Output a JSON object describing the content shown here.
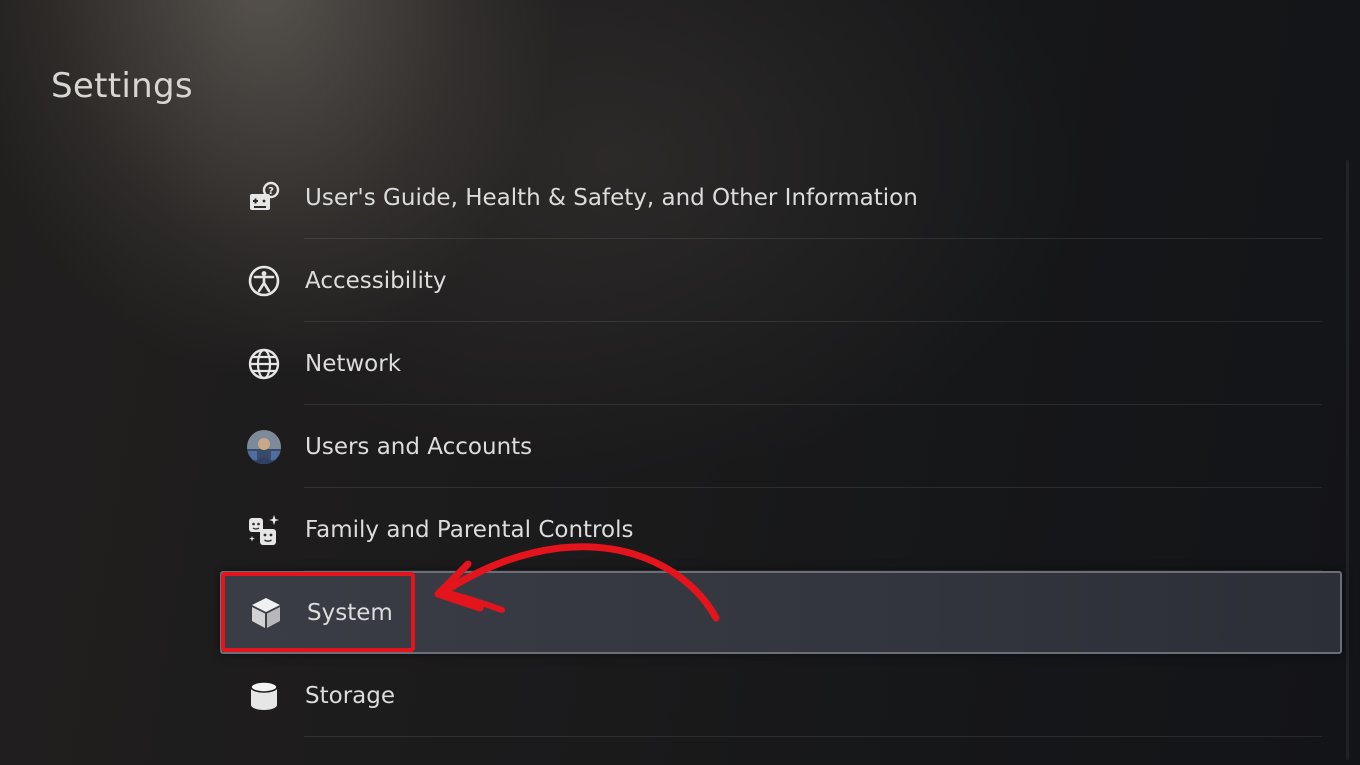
{
  "page_title": "Settings",
  "menu": {
    "items": [
      {
        "label": "User's Guide, Health & Safety, and Other Information",
        "icon": "guide-icon"
      },
      {
        "label": "Accessibility",
        "icon": "accessibility-icon"
      },
      {
        "label": "Network",
        "icon": "globe-icon"
      },
      {
        "label": "Users and Accounts",
        "icon": "user-avatar-icon"
      },
      {
        "label": "Family and Parental Controls",
        "icon": "family-icon"
      },
      {
        "label": "System",
        "icon": "cube-icon",
        "selected": true
      },
      {
        "label": "Storage",
        "icon": "storage-cylinder-icon"
      }
    ]
  },
  "annotation": {
    "highlight_color": "#e3141b",
    "highlighted_item": "System"
  },
  "colors": {
    "selected_row_border": "#6b6e78",
    "text": "#dcdcdc"
  }
}
